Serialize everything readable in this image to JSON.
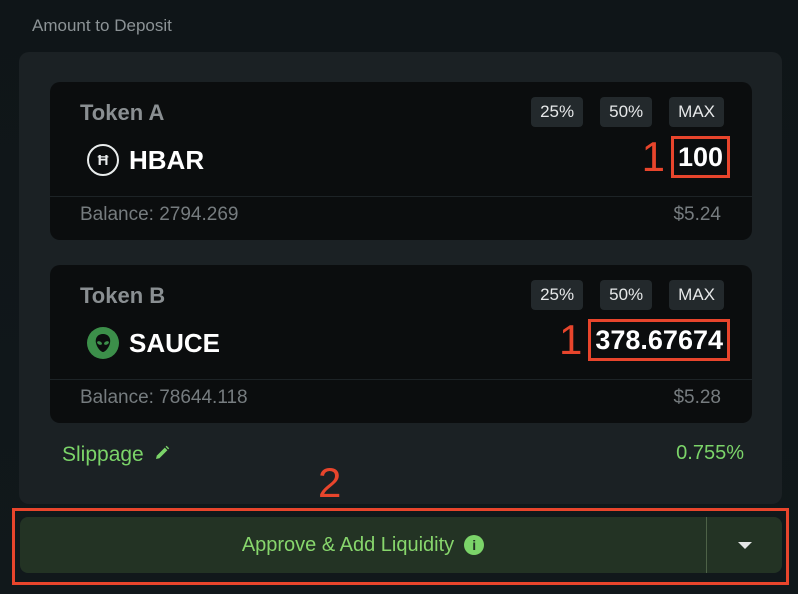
{
  "section_title": "Amount to Deposit",
  "token_a": {
    "label": "Token A",
    "quick_buttons": [
      "25%",
      "50%",
      "MAX"
    ],
    "symbol": "HBAR",
    "icon": "hbar-icon",
    "icon_glyph": "Ħ",
    "step": "1",
    "amount": "100",
    "balance": "Balance: 2794.269",
    "usd": "$5.24"
  },
  "token_b": {
    "label": "Token B",
    "quick_buttons": [
      "25%",
      "50%",
      "MAX"
    ],
    "symbol": "SAUCE",
    "icon": "alien-icon",
    "step": "1",
    "amount": "378.67674",
    "balance": "Balance: 78644.118",
    "usd": "$5.28"
  },
  "slippage": {
    "label": "Slippage",
    "icon": "pencil-icon",
    "value": "0.755%"
  },
  "action": {
    "step": "2",
    "label": "Approve & Add Liquidity",
    "info_icon": "info-icon",
    "info_glyph": "i",
    "dropdown_icon": "caret-down-icon"
  },
  "colors": {
    "accent_green": "#7bd469",
    "annotation_red": "#e8452c",
    "button_bg": "#233324"
  }
}
